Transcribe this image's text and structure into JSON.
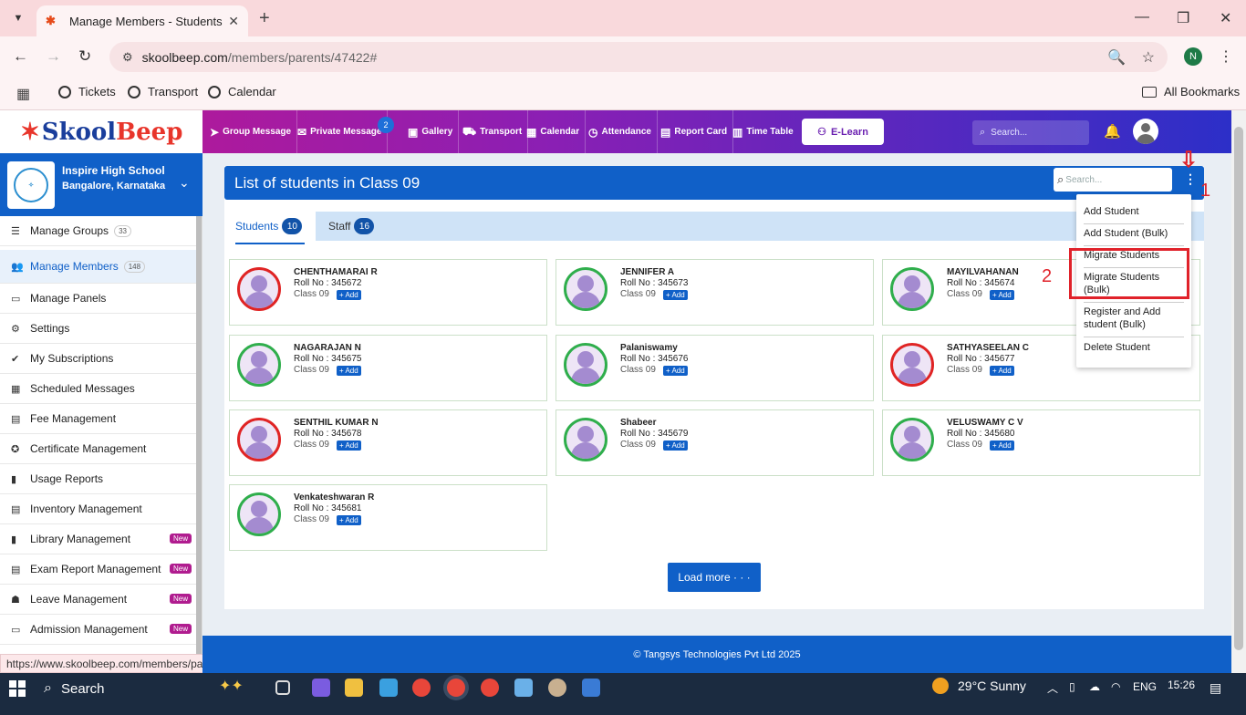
{
  "browser": {
    "tab_title": "Manage Members - Students",
    "url_host": "skoolbeep.com",
    "url_path": "/members/parents/47422#",
    "profile_initial": "N",
    "bookmarks": [
      "Tickets",
      "Transport",
      "Calendar"
    ],
    "all_bookmarks": "All Bookmarks",
    "status_url": "https://www.skoolbeep.com/members/parents/47422#"
  },
  "header": {
    "brand_prefix": "Skool",
    "brand_suffix": "Beep",
    "nav": [
      {
        "label": "Group Message",
        "icon": "send-icon"
      },
      {
        "label": "Private Message",
        "icon": "mail-icon",
        "badge": "2"
      },
      {
        "label": "Gallery",
        "icon": "image-icon"
      },
      {
        "label": "Transport",
        "icon": "bus-icon"
      },
      {
        "label": "Calendar",
        "icon": "calendar-icon"
      },
      {
        "label": "Attendance",
        "icon": "clock-icon"
      },
      {
        "label": "Report Card",
        "icon": "document-icon"
      },
      {
        "label": "Time Table",
        "icon": "table-icon"
      }
    ],
    "elearn_label": "E-Learn",
    "search_placeholder": "Search..."
  },
  "school": {
    "name": "Inspire High School",
    "location": "Bangalore, Karnataka"
  },
  "sidebar": {
    "items": [
      {
        "label": "Manage Groups",
        "count": "33"
      },
      {
        "label": "Manage Members",
        "count": "148",
        "active": true
      },
      {
        "label": "Manage Panels"
      },
      {
        "label": "Settings"
      },
      {
        "label": "My Subscriptions"
      },
      {
        "label": "Scheduled Messages"
      },
      {
        "label": "Fee Management"
      },
      {
        "label": "Certificate Management"
      },
      {
        "label": "Usage Reports"
      },
      {
        "label": "Inventory Management"
      },
      {
        "label": "Library Management",
        "badge": "New"
      },
      {
        "label": "Exam Report Management",
        "badge": "New"
      },
      {
        "label": "Leave Management",
        "badge": "New"
      },
      {
        "label": "Admission Management",
        "badge": "New"
      }
    ]
  },
  "main": {
    "title": "List of students in Class 09",
    "search_placeholder": "Search...",
    "tabs": [
      {
        "label": "Students",
        "count": "10"
      },
      {
        "label": "Staff",
        "count": "16"
      }
    ],
    "students": [
      {
        "name": "CHENTHAMARAI R",
        "roll": "Roll No : 345672",
        "class": "Class 09",
        "ring": "red"
      },
      {
        "name": "JENNIFER A",
        "roll": "Roll No : 345673",
        "class": "Class 09",
        "ring": "green"
      },
      {
        "name": "MAYILVAHANAN",
        "roll": "Roll No : 345674",
        "class": "Class 09",
        "ring": "green"
      },
      {
        "name": "NAGARAJAN N",
        "roll": "Roll No : 345675",
        "class": "Class 09",
        "ring": "green"
      },
      {
        "name": "Palaniswamy",
        "roll": "Roll No : 345676",
        "class": "Class 09",
        "ring": "green"
      },
      {
        "name": "SATHYASEELAN C",
        "roll": "Roll No : 345677",
        "class": "Class 09",
        "ring": "red"
      },
      {
        "name": "SENTHIL KUMAR N",
        "roll": "Roll No : 345678",
        "class": "Class 09",
        "ring": "red"
      },
      {
        "name": "Shabeer",
        "roll": "Roll No : 345679",
        "class": "Class 09",
        "ring": "green"
      },
      {
        "name": "VELUSWAMY C V",
        "roll": "Roll No : 345680",
        "class": "Class 09",
        "ring": "green"
      },
      {
        "name": "Venkateshwaran R",
        "roll": "Roll No : 345681",
        "class": "Class 09",
        "ring": "green"
      }
    ],
    "add_label": "+ Add",
    "load_more": "Load more · · ·",
    "dropdown": [
      "Add Student",
      "Add Student (Bulk)",
      "Migrate Students",
      "Migrate Students (Bulk)",
      "Register and Add student (Bulk)",
      "Delete Student"
    ],
    "annotation_1": "1",
    "annotation_2": "2"
  },
  "footer": {
    "text": "© Tangsys Technologies Pvt Ltd 2025"
  },
  "taskbar": {
    "search": "Search",
    "weather": "29°C  Sunny",
    "lang": "ENG",
    "time": "15:26"
  },
  "colors": {
    "primary": "#1060c8",
    "annotation": "#e0222a",
    "brand_red": "#e8352b",
    "brand_blue": "#1a3e9c"
  }
}
